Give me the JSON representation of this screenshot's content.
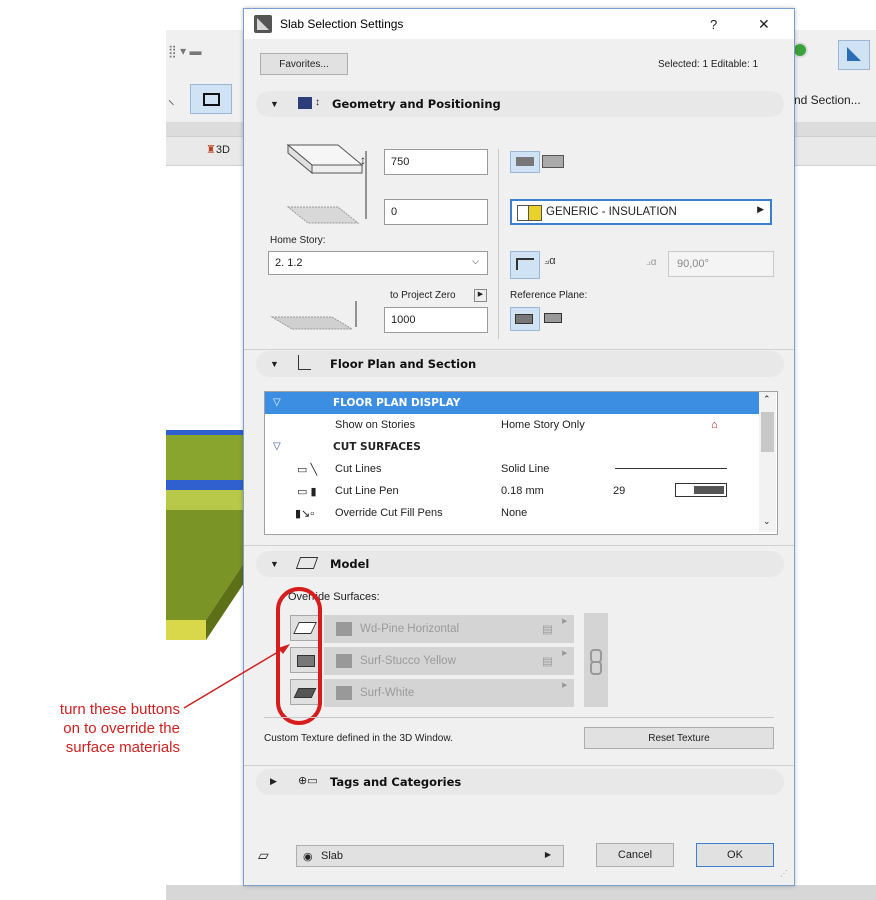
{
  "background": {
    "toolbar_label": "nd Section...",
    "tab_label": "3D"
  },
  "dialog": {
    "title": "Slab Selection Settings",
    "help_label": "?",
    "close_label": "✕",
    "favorites_label": "Favorites...",
    "selected_info": "Selected: 1 Editable: 1"
  },
  "geometry": {
    "header": "Geometry and Positioning",
    "thickness": "750",
    "offset": "0",
    "home_story_label": "Home Story:",
    "home_story_value": "2. 1.2",
    "to_project_zero_label": "to Project Zero",
    "project_zero_value": "1000",
    "building_material": "GENERIC - INSULATION",
    "angle_value": "90,00°",
    "reference_plane_label": "Reference Plane:"
  },
  "floor_plan": {
    "header": "Floor Plan and Section",
    "rows": [
      {
        "name": "FLOOR PLAN DISPLAY",
        "value": "",
        "extra": ""
      },
      {
        "name": "Show on Stories",
        "value": "Home Story Only",
        "extra": ""
      },
      {
        "name": "CUT SURFACES",
        "value": "",
        "extra": ""
      },
      {
        "name": "Cut Lines",
        "value": "Solid Line",
        "extra": ""
      },
      {
        "name": "Cut Line Pen",
        "value": "0.18 mm",
        "extra": "29"
      },
      {
        "name": "Override Cut Fill Pens",
        "value": "None",
        "extra": ""
      }
    ]
  },
  "model": {
    "header": "Model",
    "override_label": "Override Surfaces:",
    "surfaces": [
      "Wd-Pine Horizontal",
      "Surf-Stucco Yellow",
      "Surf-White"
    ],
    "custom_texture_note": "Custom Texture defined in the 3D Window.",
    "reset_texture_label": "Reset Texture"
  },
  "tags": {
    "header": "Tags and Categories"
  },
  "footer": {
    "layer_value": "Slab",
    "cancel_label": "Cancel",
    "ok_label": "OK"
  },
  "annotation": {
    "line1": "turn these buttons",
    "line2": "on to override the",
    "line3": "surface materials"
  },
  "colors": {
    "selection_blue": "#3c8ee3",
    "annotation_red": "#d02020",
    "model_yellow": "#d8d84a",
    "model_green": "#6f8a22"
  }
}
